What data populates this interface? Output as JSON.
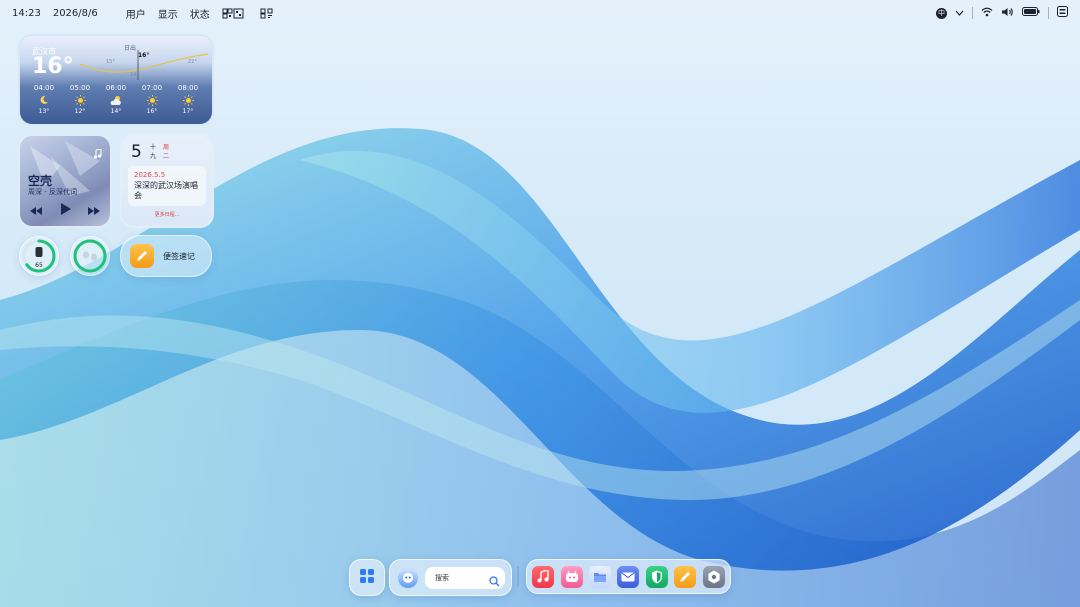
{
  "topbar": {
    "time": "14:23",
    "date": "2026/8/6",
    "menus": [
      "用户",
      "显示",
      "状态"
    ],
    "icons_left": [
      "qr-scan-icon",
      "qr-code-icon"
    ],
    "status_icons": [
      "input-method-icon",
      "chevron-down-icon",
      "wifi-icon",
      "volume-icon",
      "battery-icon",
      "control-center-icon"
    ],
    "input_method": "中"
  },
  "weather": {
    "city": "武汉市",
    "current_temp": "16°",
    "sun_label": "日出",
    "now_label": "16°",
    "curve_temps": [
      "15°",
      "14°",
      "22°"
    ],
    "hours": [
      {
        "time": "04:00",
        "icon": "moon-icon",
        "temp": "13°"
      },
      {
        "time": "05:00",
        "icon": "sun-icon",
        "temp": "12°"
      },
      {
        "time": "06:00",
        "icon": "partly-cloudy-icon",
        "temp": "14°"
      },
      {
        "time": "07:00",
        "icon": "sun-icon",
        "temp": "16°"
      },
      {
        "time": "08:00",
        "icon": "sun-icon",
        "temp": "17°"
      }
    ]
  },
  "music": {
    "title": "空壳",
    "subtitle": "周深 - 反深代词"
  },
  "calendar": {
    "day": "5",
    "lunar": [
      "十",
      "九"
    ],
    "weekday": [
      "周",
      "二"
    ],
    "event_date": "2026.5.5",
    "event_title": "深深的武汉场演唱会",
    "more": "更多日程..."
  },
  "rings": {
    "watch_value": "65",
    "watch_level": 0.65,
    "earbuds_level": 1.0
  },
  "note": {
    "label": "便签速记"
  },
  "dock": {
    "search_placeholder": "搜索",
    "apps": [
      "music-app-icon",
      "character-app-icon",
      "files-app-icon",
      "mail-app-icon",
      "security-app-icon",
      "notes-app-icon",
      "settings-app-icon"
    ]
  },
  "colors": {
    "ring_green": "#1ec27a",
    "accent_blue": "#2f7bf2",
    "calendar_red": "#e23b3b"
  }
}
